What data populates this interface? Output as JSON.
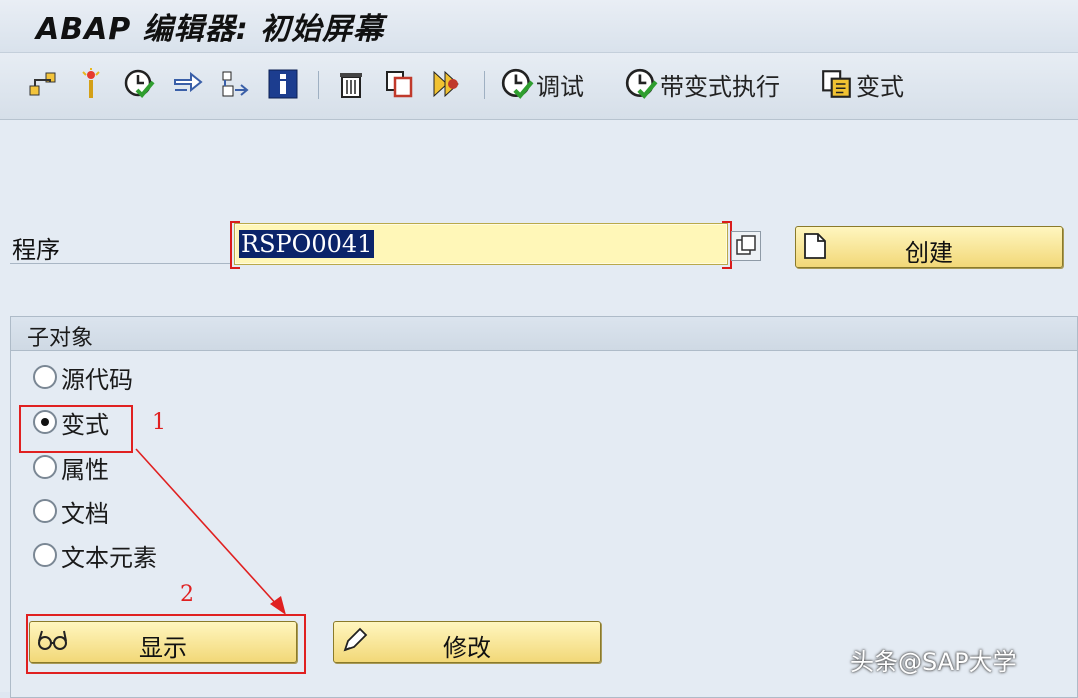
{
  "window": {
    "title": "ABAP 编辑器: 初始屏幕"
  },
  "toolbar": {
    "icons": [
      "hierarchy-icon",
      "wand-icon",
      "check-clock-icon",
      "arrows-icon",
      "where-used-icon",
      "info-icon",
      "delete-icon",
      "copy-icon",
      "rename-icon"
    ],
    "debug_label": "调试",
    "exec_variant_label": "带变式执行",
    "variant_label": "变式"
  },
  "program": {
    "label": "程序",
    "value": "RSPO0041",
    "create_label": "创建"
  },
  "subobjects": {
    "title": "子对象",
    "options": [
      {
        "label": "源代码",
        "selected": false
      },
      {
        "label": "变式",
        "selected": true
      },
      {
        "label": "属性",
        "selected": false
      },
      {
        "label": "文档",
        "selected": false
      },
      {
        "label": "文本元素",
        "selected": false
      }
    ]
  },
  "actions": {
    "display_label": "显示",
    "change_label": "修改"
  },
  "annotations": {
    "step1": "1",
    "step2": "2",
    "color": "#e02020"
  },
  "watermark": "头条@SAP大学"
}
